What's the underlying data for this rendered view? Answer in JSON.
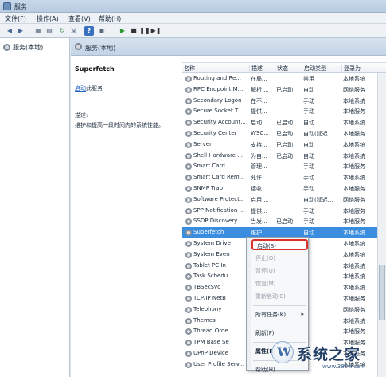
{
  "window": {
    "title": "服务"
  },
  "menu": [
    "文件(F)",
    "操作(A)",
    "查看(V)",
    "帮助(H)"
  ],
  "toolbar": [
    {
      "icon": "back-arrow-icon",
      "glyph": "◀",
      "color": "#4a6a9a"
    },
    {
      "icon": "forward-arrow-icon",
      "glyph": "▶",
      "color": "#4a6a9a"
    },
    {
      "icon": "console-tree-icon",
      "glyph": "▦",
      "color": "#5b6b7c"
    },
    {
      "icon": "properties-list-icon",
      "glyph": "▤",
      "color": "#5b6b7c"
    },
    {
      "icon": "refresh-icon",
      "glyph": "↻",
      "color": "#3a8a3a"
    },
    {
      "icon": "export-list-icon",
      "glyph": "⇲",
      "color": "#5b6b7c"
    },
    {
      "icon": "help-icon",
      "glyph": "?",
      "color": "#ffffff"
    },
    {
      "icon": "view-icon",
      "glyph": "▣",
      "color": "#5b6b7c"
    },
    {
      "icon": "start-service-icon",
      "glyph": "▶",
      "color": "#2e9a2e"
    },
    {
      "icon": "stop-service-icon",
      "glyph": "■",
      "color": "#333333"
    },
    {
      "icon": "pause-service-icon",
      "glyph": "❚❚",
      "color": "#333333"
    },
    {
      "icon": "restart-service-icon",
      "glyph": "▶❚",
      "color": "#333333"
    }
  ],
  "tree": {
    "node": "服务(本地)"
  },
  "main_header": "服务(本地)",
  "detail": {
    "service_name": "Superfetch",
    "start_link": "启动",
    "start_suffix": "此服务",
    "description_label": "描述:",
    "description": "维护和提高一段时间内的系统性能。"
  },
  "columns": [
    "名称",
    "描述",
    "状态",
    "启动类型",
    "登录为"
  ],
  "services": [
    {
      "name": "Routing and Re...",
      "desc": "在局...",
      "status": "",
      "startup": "禁用",
      "logon": "本地系统"
    },
    {
      "name": "RPC Endpoint M...",
      "desc": "解析 ...",
      "status": "已启动",
      "startup": "自动",
      "logon": "网络服务"
    },
    {
      "name": "Secondary Logon",
      "desc": "在不...",
      "status": "",
      "startup": "手动",
      "logon": "本地系统"
    },
    {
      "name": "Secure Socket T...",
      "desc": "提供...",
      "status": "",
      "startup": "手动",
      "logon": "本地服务"
    },
    {
      "name": "Security Account...",
      "desc": "启动...",
      "status": "已启动",
      "startup": "自动",
      "logon": "本地系统"
    },
    {
      "name": "Security Center",
      "desc": "WSC...",
      "status": "已启动",
      "startup": "自动(延迟...",
      "logon": "本地服务"
    },
    {
      "name": "Server",
      "desc": "支持...",
      "status": "已启动",
      "startup": "自动",
      "logon": "本地系统"
    },
    {
      "name": "Shell Hardware ...",
      "desc": "为自...",
      "status": "已启动",
      "startup": "自动",
      "logon": "本地系统"
    },
    {
      "name": "Smart Card",
      "desc": "管理...",
      "status": "",
      "startup": "手动",
      "logon": "本地服务"
    },
    {
      "name": "Smart Card Rem...",
      "desc": "允许...",
      "status": "",
      "startup": "手动",
      "logon": "本地系统"
    },
    {
      "name": "SNMP Trap",
      "desc": "接收...",
      "status": "",
      "startup": "手动",
      "logon": "本地服务"
    },
    {
      "name": "Software Protect...",
      "desc": "启用 ...",
      "status": "",
      "startup": "自动(延迟...",
      "logon": "网络服务"
    },
    {
      "name": "SPP Notification ...",
      "desc": "提供...",
      "status": "",
      "startup": "手动",
      "logon": "本地服务"
    },
    {
      "name": "SSDP Discovery",
      "desc": "当发...",
      "status": "已启动",
      "startup": "手动",
      "logon": "本地服务"
    },
    {
      "name": "Superfetch",
      "desc": "维护...",
      "status": "",
      "startup": "自动",
      "logon": "本地系统",
      "selected": true
    },
    {
      "name": "System Drive",
      "desc": "",
      "status": "",
      "startup": "",
      "logon": "本地系统"
    },
    {
      "name": "System Even",
      "desc": "",
      "status": "",
      "startup": "",
      "logon": "本地系统"
    },
    {
      "name": "Tablet PC In",
      "desc": "",
      "status": "",
      "startup": "",
      "logon": "本地系统"
    },
    {
      "name": "Task Schedu",
      "desc": "",
      "status": "",
      "startup": "",
      "logon": "本地系统"
    },
    {
      "name": "TBSecSvc",
      "desc": "",
      "status": "",
      "startup": "",
      "logon": "本地系统"
    },
    {
      "name": "TCP/IP NetB",
      "desc": "",
      "status": "",
      "startup": "",
      "logon": "本地服务"
    },
    {
      "name": "Telephony",
      "desc": "",
      "status": "",
      "startup": "",
      "logon": "网络服务"
    },
    {
      "name": "Themes",
      "desc": "",
      "status": "",
      "startup": "",
      "logon": "本地系统"
    },
    {
      "name": "Thread Orde",
      "desc": "",
      "status": "",
      "startup": "",
      "logon": "本地服务"
    },
    {
      "name": "TPM Base Se",
      "desc": "",
      "status": "",
      "startup": "",
      "logon": "本地服务"
    },
    {
      "name": "UPnP Device",
      "desc": "",
      "status": "",
      "startup": "",
      "logon": "本地服务"
    },
    {
      "name": "User Profile Serv...",
      "desc": "此服...",
      "status": "已启动",
      "startup": "",
      "logon": "本地系统"
    }
  ],
  "context_menu": [
    {
      "label": "启动(S)",
      "state": "highlighted"
    },
    {
      "label": "停止(O)",
      "state": "disabled"
    },
    {
      "label": "暂停(U)",
      "state": "disabled"
    },
    {
      "label": "恢复(M)",
      "state": "disabled"
    },
    {
      "label": "重新启动(E)",
      "state": "disabled"
    },
    {
      "sep": true
    },
    {
      "label": "所有任务(K)",
      "state": "normal",
      "submenu": true
    },
    {
      "sep": true
    },
    {
      "label": "刷新(F)",
      "state": "normal"
    },
    {
      "sep": true
    },
    {
      "label": "属性(R)",
      "state": "bold"
    },
    {
      "sep": true
    },
    {
      "label": "帮助(H)",
      "state": "normal"
    }
  ],
  "watermark": {
    "brand": "系统之家",
    "mark": "W",
    "url": "www.386w.com"
  },
  "colors": {
    "selection": "#3b8de0",
    "highlight_border": "#d9322b",
    "link": "#1f5fbf"
  }
}
